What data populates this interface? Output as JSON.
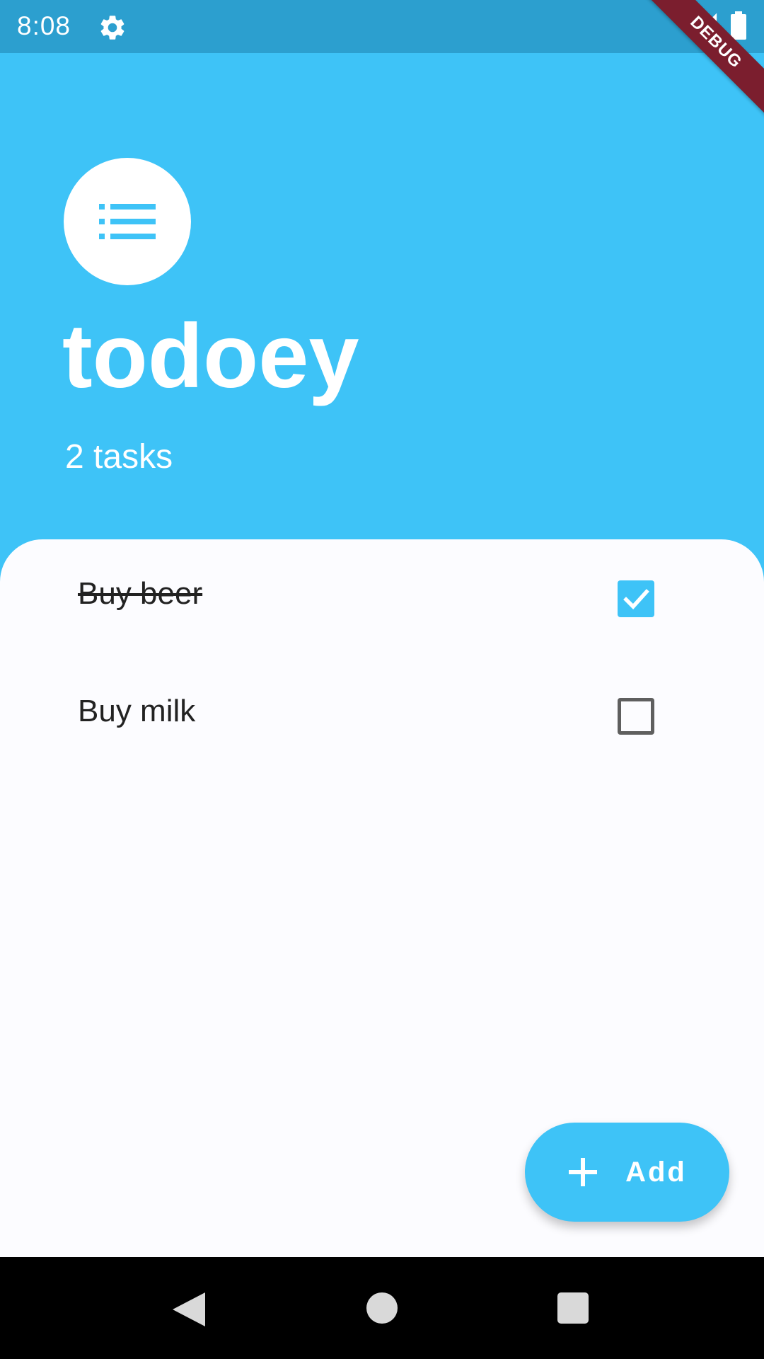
{
  "status_bar": {
    "time": "8:08",
    "icons": [
      "gear-icon",
      "signal-icon",
      "battery-icon"
    ]
  },
  "debug_banner": {
    "label": "DEBUG"
  },
  "header": {
    "avatar_icon": "list-icon",
    "title": "todoey",
    "task_count": "2 tasks"
  },
  "tasks": [
    {
      "label": "Buy beer",
      "done": true
    },
    {
      "label": "Buy milk",
      "done": false
    }
  ],
  "fab": {
    "icon": "plus-icon",
    "label": "Add"
  },
  "nav_bar": {
    "icons": [
      "back-icon",
      "home-icon",
      "recents-icon"
    ]
  },
  "colors": {
    "accent": "#3EC3F7",
    "status_bar": "#2C9FCF",
    "card": "#FCFCFF",
    "debug_ribbon": "#7B1E2E"
  }
}
